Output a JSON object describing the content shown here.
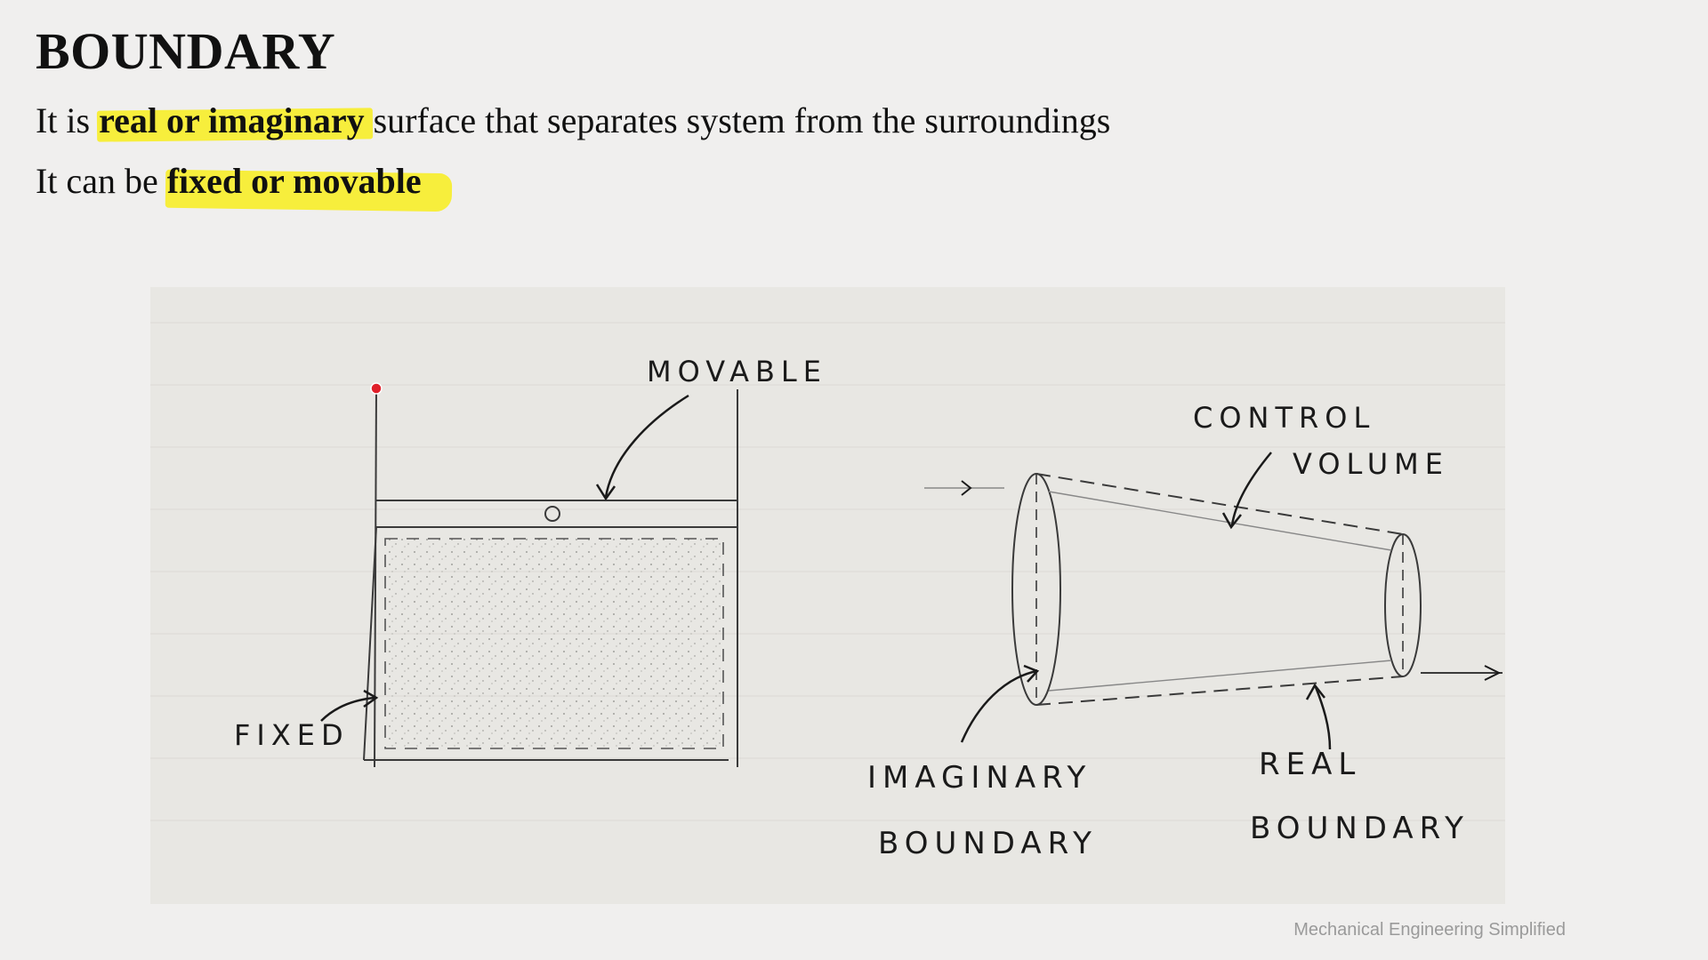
{
  "slide": {
    "title": "BOUNDARY",
    "line1": {
      "prefix": "It is ",
      "highlight": "real or imaginary",
      "suffix": " surface that separates system from the surroundings"
    },
    "line2": {
      "prefix": "It can be ",
      "highlight": "fixed or movable"
    }
  },
  "sketch": {
    "labels": {
      "movable": "MOVABLE",
      "fixed": "FIXED",
      "control": "CONTROL",
      "volume": "VOLUME",
      "imaginary": "IMAGINARY",
      "imaginary_boundary": "BOUNDARY",
      "real": "REAL",
      "real_boundary": "BOUNDARY"
    },
    "colors": {
      "highlight": "#f7ee3c",
      "pointer": "#e0202a",
      "paper": "#e8e7e3"
    }
  },
  "footer": {
    "watermark": "Mechanical Engineering Simplified"
  }
}
